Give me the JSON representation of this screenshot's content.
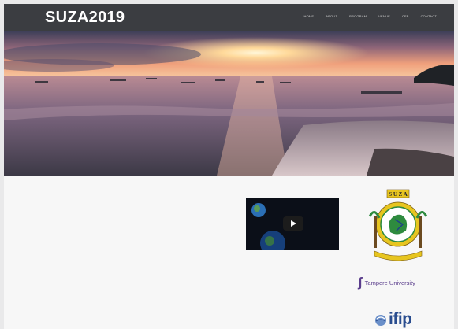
{
  "site": {
    "title": "SUZA2019"
  },
  "nav": {
    "items": [
      {
        "label": "HOME"
      },
      {
        "label": "ABOUT"
      },
      {
        "label": "PROGRAM"
      },
      {
        "label": "VENUE"
      },
      {
        "label": "CFP"
      },
      {
        "label": "CONTACT"
      }
    ]
  },
  "hero": {
    "caption_lines": [
      "",
      "",
      ""
    ],
    "link_text": ""
  },
  "sections": {
    "left": {
      "title": "",
      "text": ""
    },
    "middle": {
      "title": "",
      "text": ""
    },
    "right": {
      "title": ""
    }
  },
  "video": {
    "title": ""
  },
  "sponsors": {
    "suza_seal_text": "S U Z A",
    "tampere": "Tampere University",
    "ifip": "ifip"
  },
  "colors": {
    "topbar": "#3b3d41",
    "tampere_purple": "#5a3d8c",
    "ifip_blue": "#2a4d8f",
    "seal_yellow": "#e7c51f",
    "seal_green": "#2e8b3f"
  }
}
